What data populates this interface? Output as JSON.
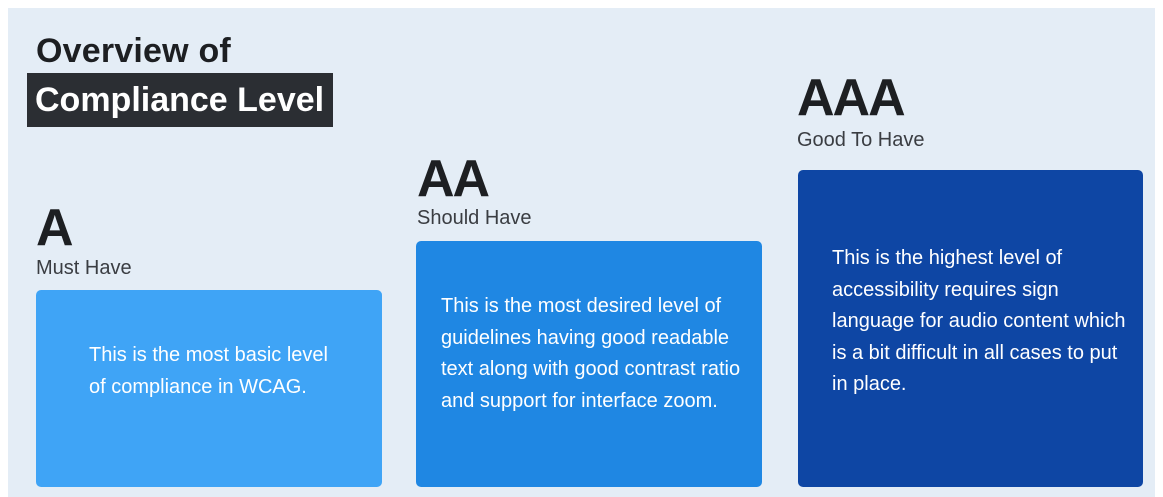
{
  "title": {
    "line1": "Overview of",
    "line2": "Compliance Level"
  },
  "colors": {
    "background": "#e4edf6",
    "title_highlight": "#2b2e33",
    "card_a": "#3fa4f6",
    "card_aa": "#1f87e3",
    "card_aaa": "#0e46a4"
  },
  "levels": [
    {
      "code": "A",
      "priority": "Must Have",
      "description": "This is the most basic level of compliance in WCAG."
    },
    {
      "code": "AA",
      "priority": "Should Have",
      "description": "This is the most desired level of guidelines having good readable text along with good contrast ratio and support for interface zoom."
    },
    {
      "code": "AAA",
      "priority": "Good To Have",
      "description": "This is the highest level of accessibility requires sign language for audio content which is a bit difficult in all cases to put in place."
    }
  ]
}
